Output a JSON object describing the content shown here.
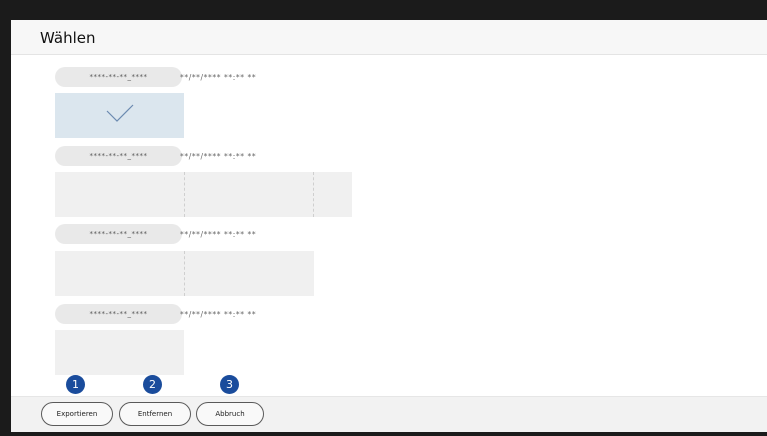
{
  "header": {
    "title": "Wählen"
  },
  "groups": [
    {
      "label": "****-**-**_****",
      "date": "**/**/**** **:** **"
    },
    {
      "label": "****-**-**_****",
      "date": "**/**/**** **:** **"
    },
    {
      "label": "****-**-**_****",
      "date": "**/**/**** **:** **"
    },
    {
      "label": "****-**-**_****",
      "date": "**/**/**** **:** **"
    }
  ],
  "footer": {
    "export_label": "Exportieren",
    "remove_label": "Entfernen",
    "cancel_label": "Abbruch"
  },
  "callouts": [
    "1",
    "2",
    "3"
  ],
  "colors": {
    "accent": "#1a4c9c",
    "selected": "#dbe6ee",
    "check": "#6b8ab0"
  }
}
